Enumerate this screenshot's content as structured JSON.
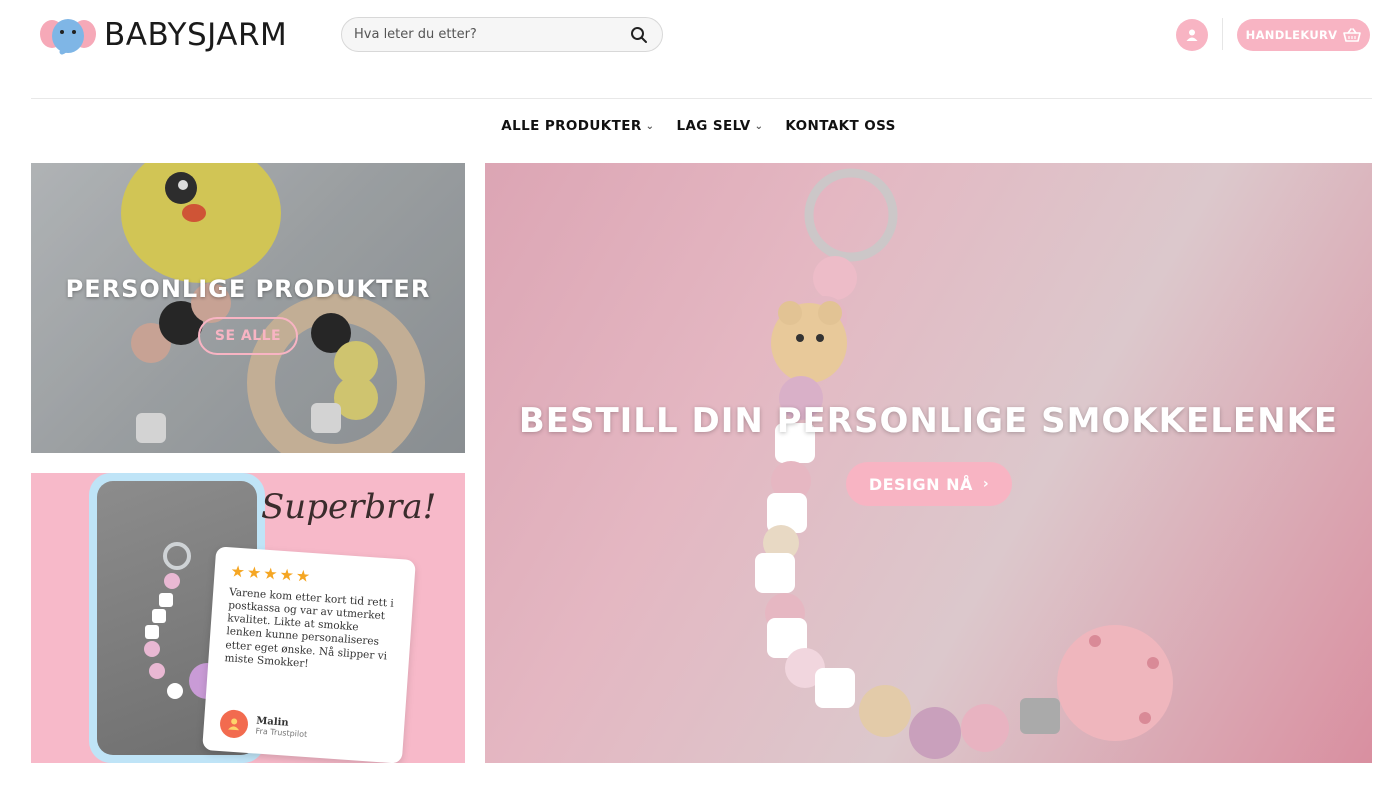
{
  "brand": {
    "name": "BABYSJARM"
  },
  "search": {
    "placeholder": "Hva leter du etter?",
    "value": ""
  },
  "header": {
    "cart_label": "HANDLEKURV"
  },
  "nav": {
    "items": [
      {
        "label": "ALLE PRODUKTER",
        "has_dropdown": true
      },
      {
        "label": "LAG SELV",
        "has_dropdown": true
      },
      {
        "label": "KONTAKT OSS",
        "has_dropdown": false
      }
    ]
  },
  "banners": {
    "personal": {
      "title": "PERSONLIGE PRODUKTER",
      "button": "SE ALLE"
    },
    "hero": {
      "title": "BESTILL DIN PERSONLIGE SMOKKELENKE",
      "button": "DESIGN NÅ",
      "button_icon": "chevron-right-icon"
    },
    "review": {
      "headline": "Superbra!",
      "stars": "★★★★★",
      "text": "Varene kom etter kort tid rett i postkassa og var av utmerket kvalitet. Likte at smokke lenken kunne personaliseres etter eget ønske. Nå slipper vi miste Smokker!",
      "reviewer": "Malin",
      "source": "Fra Trustpilot"
    }
  },
  "colors": {
    "accent": "#f8b4c3",
    "text": "#111111",
    "star": "#f5a623"
  }
}
